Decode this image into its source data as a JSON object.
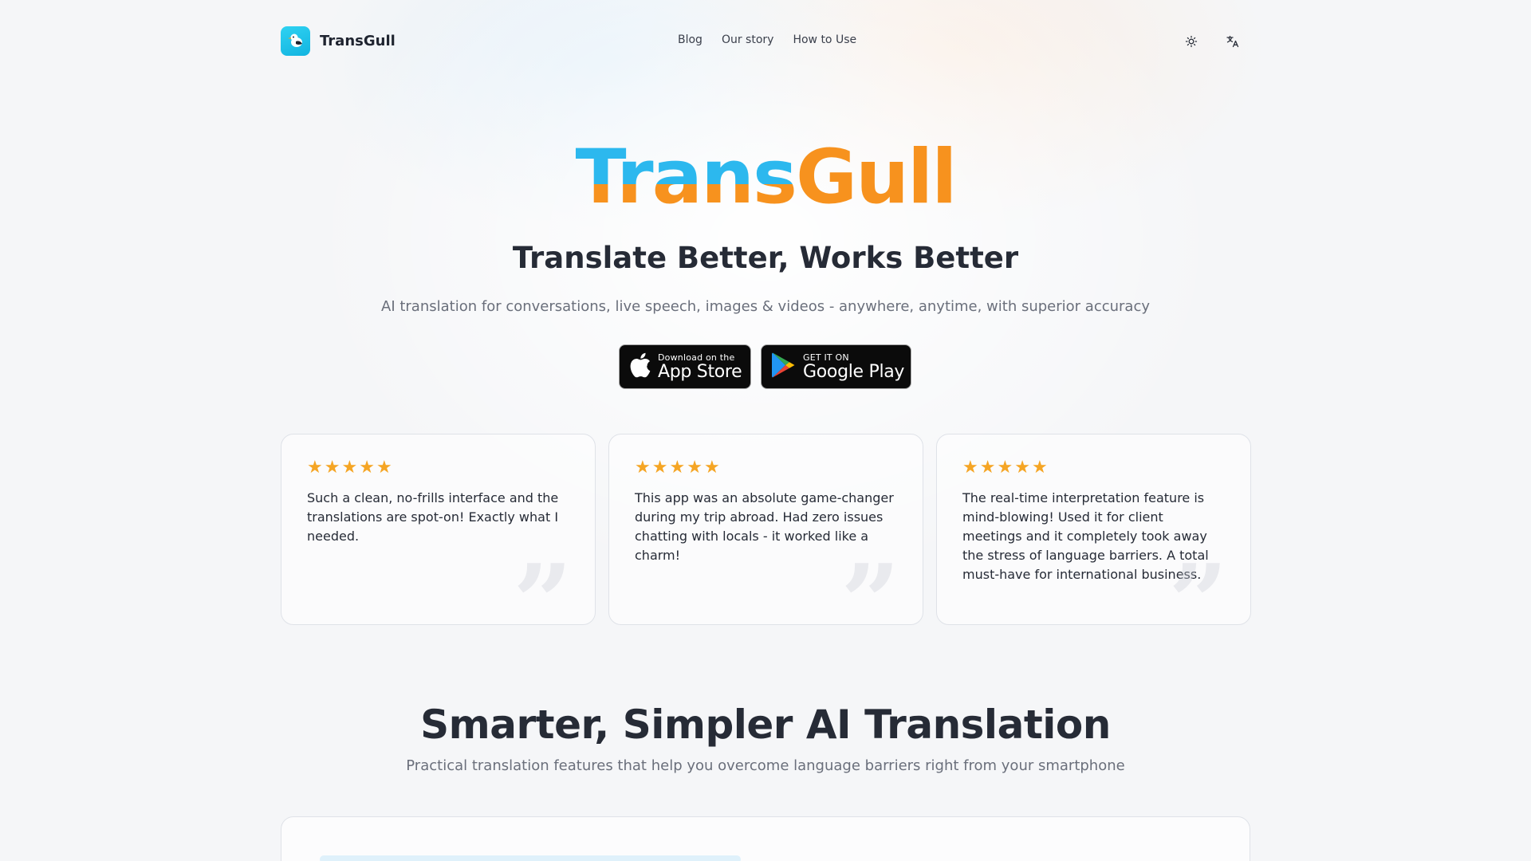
{
  "brand": {
    "name": "TransGull",
    "logo_icon": "seagull-logo-icon"
  },
  "nav": {
    "items": [
      "Blog",
      "Our story",
      "How to Use"
    ]
  },
  "header_icons": [
    "sun-icon",
    "translate-icon"
  ],
  "hero": {
    "title_part1": "Trans",
    "title_part2": "Gull",
    "subtitle": "Translate Better, Works Better",
    "description": "AI translation for conversations, live speech, images & videos - anywhere, anytime, with superior accuracy"
  },
  "stores": {
    "apple": {
      "small": "Download on the",
      "big": "App Store"
    },
    "google": {
      "small": "GET IT ON",
      "big": "Google Play"
    }
  },
  "reviews": [
    {
      "stars": 5,
      "text": "Such a clean, no-frills interface and the translations are spot-on! Exactly what I needed."
    },
    {
      "stars": 5,
      "text": "This app was an absolute game-changer during my trip abroad. Had zero issues chatting with locals - it worked like a charm!"
    },
    {
      "stars": 5,
      "text": "The real-time interpretation feature is mind-blowing! Used it for client meetings and it completely took away the stress of language barriers. A total must-have for international business."
    }
  ],
  "features": {
    "title": "Smarter, Simpler AI Translation",
    "subtitle": "Practical translation features that help you overcome language barriers right from your smartphone"
  },
  "colors": {
    "brand_blue": "#2cb8ee",
    "brand_orange": "#f7921e",
    "star": "#f5a524"
  }
}
